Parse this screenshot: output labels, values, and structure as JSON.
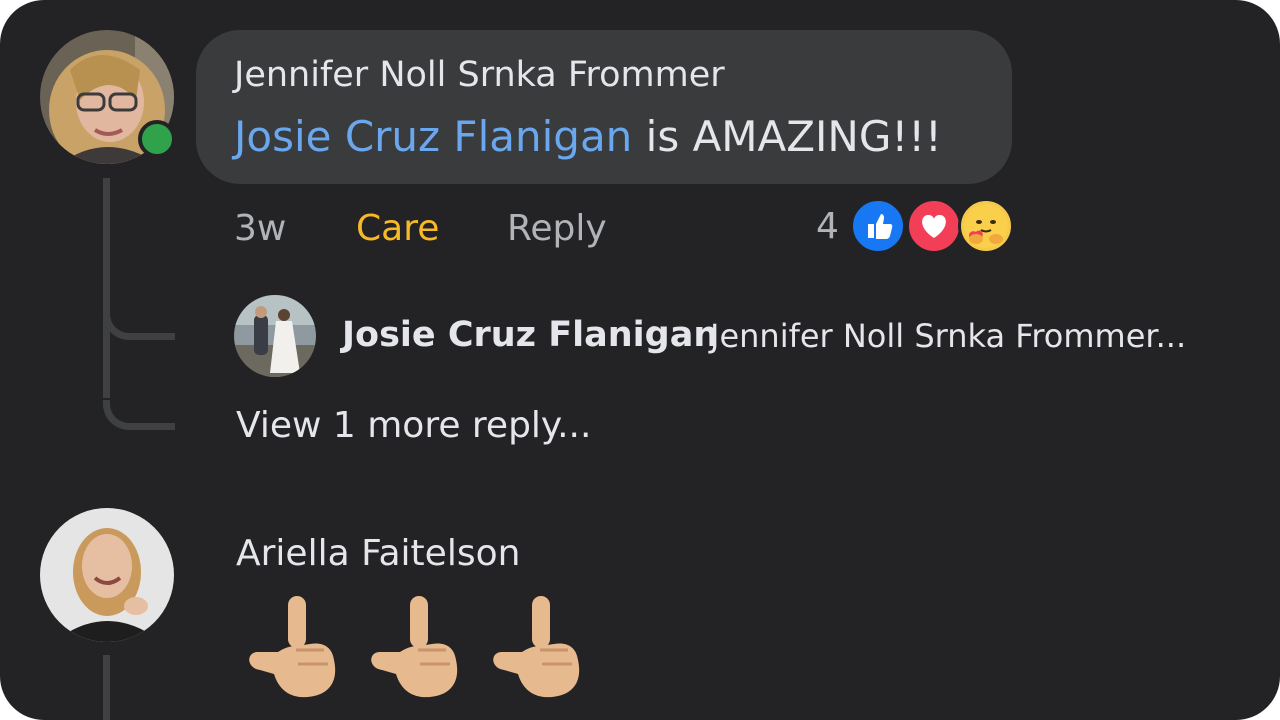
{
  "comment1": {
    "author": "Jennifer Noll Srnka Frommer",
    "mention": "Josie Cruz Flanigan",
    "text": " is AMAZING!!!",
    "time": "3w",
    "care_label": "Care",
    "reply_label": "Reply",
    "reaction_count": "4",
    "reactions": [
      "like-icon",
      "love-icon",
      "care-icon"
    ]
  },
  "reply1": {
    "author": "Josie Cruz Flanigan",
    "snippet": "Jennifer Noll Srnka Frommer..."
  },
  "view_more": "View 1 more reply...",
  "comment2": {
    "author": "Ariella Faitelson",
    "emoji": [
      "point-down-icon",
      "point-down-icon",
      "point-down-icon"
    ]
  },
  "colors": {
    "background": "#232325",
    "bubble": "#3a3b3d",
    "mention": "#6aa7ee",
    "care": "#f7b928",
    "online": "#31a24c",
    "like": "#1877f2",
    "love": "#f33e58"
  }
}
